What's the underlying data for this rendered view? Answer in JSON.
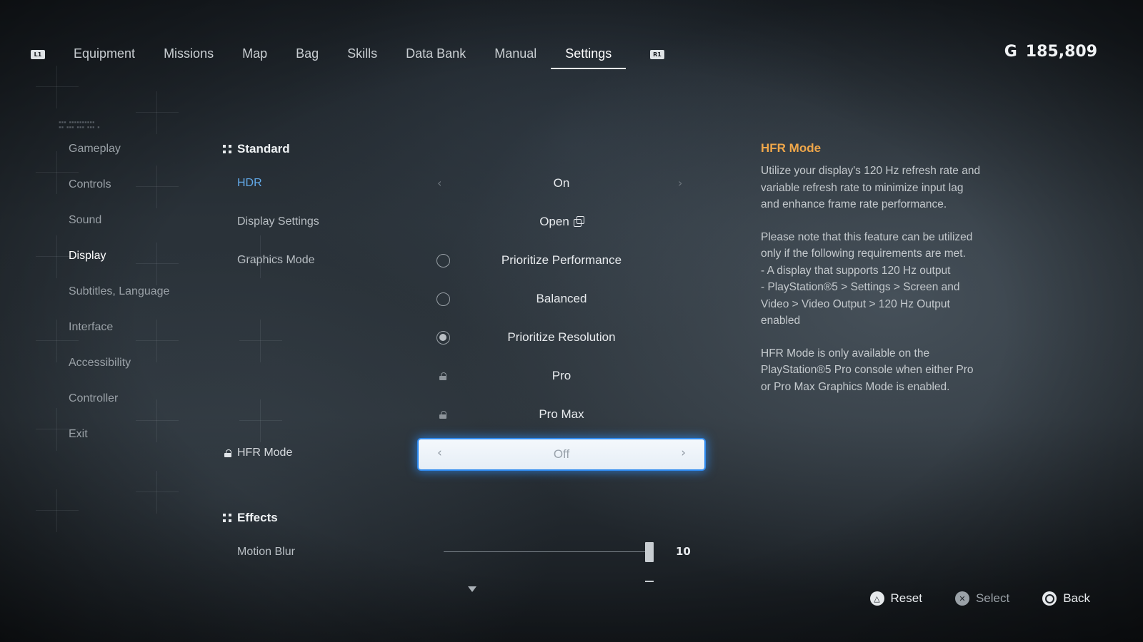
{
  "topbar": {
    "left_shoulder": "L1",
    "right_shoulder": "R1",
    "tabs": [
      {
        "label": "Equipment"
      },
      {
        "label": "Missions"
      },
      {
        "label": "Map"
      },
      {
        "label": "Bag"
      },
      {
        "label": "Skills"
      },
      {
        "label": "Data Bank"
      },
      {
        "label": "Manual"
      },
      {
        "label": "Settings",
        "active": true
      }
    ],
    "currency_symbol": "G",
    "currency_value": "185,809"
  },
  "sidebar": {
    "items": [
      {
        "label": "Gameplay"
      },
      {
        "label": "Controls"
      },
      {
        "label": "Sound"
      },
      {
        "label": "Display",
        "active": true
      },
      {
        "label": "Subtitles, Language"
      },
      {
        "label": "Interface"
      },
      {
        "label": "Accessibility"
      },
      {
        "label": "Controller"
      },
      {
        "label": "Exit"
      }
    ]
  },
  "standard": {
    "heading": "Standard",
    "hdr": {
      "label": "HDR",
      "value": "On"
    },
    "display_settings": {
      "label": "Display Settings",
      "value": "Open"
    },
    "graphics_mode": {
      "label": "Graphics Mode",
      "options": [
        {
          "label": "Prioritize Performance",
          "state": "unselected"
        },
        {
          "label": "Balanced",
          "state": "unselected"
        },
        {
          "label": "Prioritize Resolution",
          "state": "selected"
        },
        {
          "label": "Pro",
          "state": "locked"
        },
        {
          "label": "Pro Max",
          "state": "locked"
        }
      ]
    },
    "hfr_mode": {
      "label": "HFR Mode",
      "value": "Off",
      "locked": true
    }
  },
  "effects": {
    "heading": "Effects",
    "motion_blur": {
      "label": "Motion Blur",
      "value": "10",
      "fraction": 1.0
    }
  },
  "description": {
    "title": "HFR Mode",
    "paragraphs": [
      "Utilize your display's 120 Hz refresh rate and\nvariable refresh rate to minimize input lag\nand enhance frame rate performance.",
      "Please note that this feature can be utilized\nonly if the following requirements are met.\n- A display that supports 120 Hz output\n- PlayStation®5 > Settings > Screen and\nVideo > Video Output > 120 Hz Output\nenabled",
      "HFR Mode is only available on the\nPlayStation®5 Pro console when either Pro\nor Pro Max Graphics Mode is enabled."
    ]
  },
  "prompts": {
    "reset": "Reset",
    "select": "Select",
    "back": "Back"
  },
  "colors": {
    "accent_blue": "#2f8bf0",
    "highlight_label": "#62a9e8",
    "description_title": "#f0a74a"
  }
}
